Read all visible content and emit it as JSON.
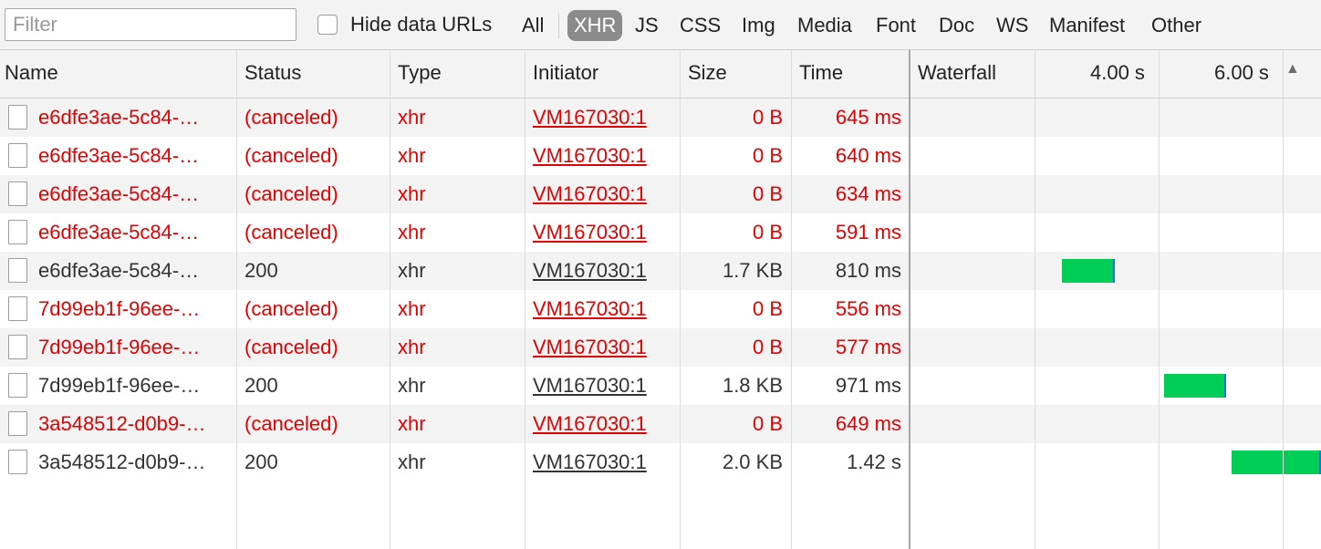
{
  "toolbar": {
    "filter_placeholder": "Filter",
    "hide_data_urls_label": "Hide data URLs",
    "types": [
      "All",
      "XHR",
      "JS",
      "CSS",
      "Img",
      "Media",
      "Font",
      "Doc",
      "WS",
      "Manifest",
      "Other"
    ],
    "active_type": "XHR"
  },
  "columns": {
    "name": "Name",
    "status": "Status",
    "type": "Type",
    "initiator": "Initiator",
    "size": "Size",
    "time": "Time",
    "waterfall": "Waterfall",
    "tick_1": "4.00 s",
    "tick_2": "6.00 s",
    "sort_icon": "triangle-up-icon"
  },
  "colors": {
    "error_text": "#e00000",
    "normal_text": "#333333",
    "waterfall_bar": "#00cd55",
    "active_filter_bg": "#8b8b8b"
  },
  "rows": [
    {
      "name": "e6dfe3ae-5c84-…",
      "status": "(canceled)",
      "type": "xhr",
      "initiator": "VM167030:1",
      "size": "0 B",
      "time": "645 ms",
      "error": true
    },
    {
      "name": "e6dfe3ae-5c84-…",
      "status": "(canceled)",
      "type": "xhr",
      "initiator": "VM167030:1",
      "size": "0 B",
      "time": "640 ms",
      "error": true
    },
    {
      "name": "e6dfe3ae-5c84-…",
      "status": "(canceled)",
      "type": "xhr",
      "initiator": "VM167030:1",
      "size": "0 B",
      "time": "634 ms",
      "error": true
    },
    {
      "name": "e6dfe3ae-5c84-…",
      "status": "(canceled)",
      "type": "xhr",
      "initiator": "VM167030:1",
      "size": "0 B",
      "time": "591 ms",
      "error": true
    },
    {
      "name": "e6dfe3ae-5c84-…",
      "status": "200",
      "type": "xhr",
      "initiator": "VM167030:1",
      "size": "1.7 KB",
      "time": "810 ms",
      "error": false
    },
    {
      "name": "7d99eb1f-96ee-…",
      "status": "(canceled)",
      "type": "xhr",
      "initiator": "VM167030:1",
      "size": "0 B",
      "time": "556 ms",
      "error": true
    },
    {
      "name": "7d99eb1f-96ee-…",
      "status": "(canceled)",
      "type": "xhr",
      "initiator": "VM167030:1",
      "size": "0 B",
      "time": "577 ms",
      "error": true
    },
    {
      "name": "7d99eb1f-96ee-…",
      "status": "200",
      "type": "xhr",
      "initiator": "VM167030:1",
      "size": "1.8 KB",
      "time": "971 ms",
      "error": false
    },
    {
      "name": "3a548512-d0b9-…",
      "status": "(canceled)",
      "type": "xhr",
      "initiator": "VM167030:1",
      "size": "0 B",
      "time": "649 ms",
      "error": true
    },
    {
      "name": "3a548512-d0b9-…",
      "status": "200",
      "type": "xhr",
      "initiator": "VM167030:1",
      "size": "2.0 KB",
      "time": "1.42 s",
      "error": false
    }
  ]
}
